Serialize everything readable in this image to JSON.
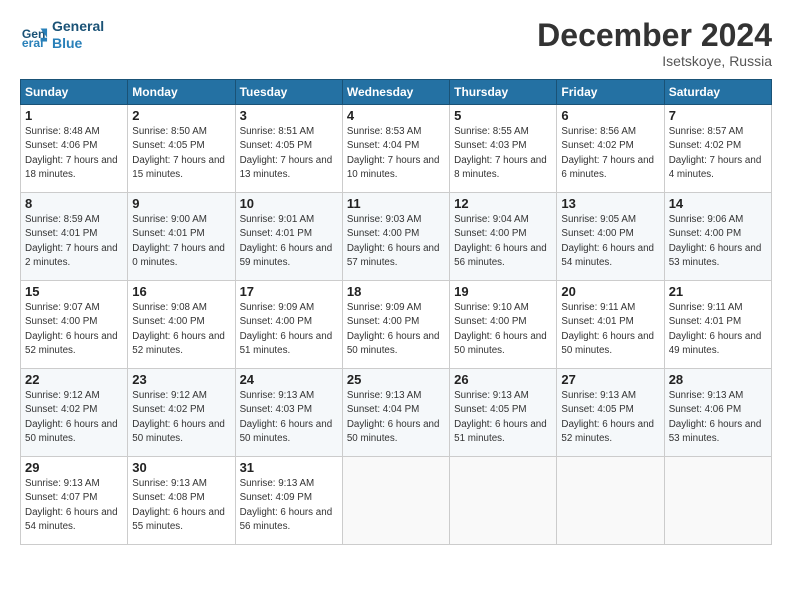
{
  "logo": {
    "line1": "General",
    "line2": "Blue"
  },
  "title": "December 2024",
  "location": "Isetskoye, Russia",
  "weekdays": [
    "Sunday",
    "Monday",
    "Tuesday",
    "Wednesday",
    "Thursday",
    "Friday",
    "Saturday"
  ],
  "weeks": [
    [
      {
        "day": "1",
        "rise": "Sunrise: 8:48 AM",
        "set": "Sunset: 4:06 PM",
        "daylight": "Daylight: 7 hours and 18 minutes."
      },
      {
        "day": "2",
        "rise": "Sunrise: 8:50 AM",
        "set": "Sunset: 4:05 PM",
        "daylight": "Daylight: 7 hours and 15 minutes."
      },
      {
        "day": "3",
        "rise": "Sunrise: 8:51 AM",
        "set": "Sunset: 4:05 PM",
        "daylight": "Daylight: 7 hours and 13 minutes."
      },
      {
        "day": "4",
        "rise": "Sunrise: 8:53 AM",
        "set": "Sunset: 4:04 PM",
        "daylight": "Daylight: 7 hours and 10 minutes."
      },
      {
        "day": "5",
        "rise": "Sunrise: 8:55 AM",
        "set": "Sunset: 4:03 PM",
        "daylight": "Daylight: 7 hours and 8 minutes."
      },
      {
        "day": "6",
        "rise": "Sunrise: 8:56 AM",
        "set": "Sunset: 4:02 PM",
        "daylight": "Daylight: 7 hours and 6 minutes."
      },
      {
        "day": "7",
        "rise": "Sunrise: 8:57 AM",
        "set": "Sunset: 4:02 PM",
        "daylight": "Daylight: 7 hours and 4 minutes."
      }
    ],
    [
      {
        "day": "8",
        "rise": "Sunrise: 8:59 AM",
        "set": "Sunset: 4:01 PM",
        "daylight": "Daylight: 7 hours and 2 minutes."
      },
      {
        "day": "9",
        "rise": "Sunrise: 9:00 AM",
        "set": "Sunset: 4:01 PM",
        "daylight": "Daylight: 7 hours and 0 minutes."
      },
      {
        "day": "10",
        "rise": "Sunrise: 9:01 AM",
        "set": "Sunset: 4:01 PM",
        "daylight": "Daylight: 6 hours and 59 minutes."
      },
      {
        "day": "11",
        "rise": "Sunrise: 9:03 AM",
        "set": "Sunset: 4:00 PM",
        "daylight": "Daylight: 6 hours and 57 minutes."
      },
      {
        "day": "12",
        "rise": "Sunrise: 9:04 AM",
        "set": "Sunset: 4:00 PM",
        "daylight": "Daylight: 6 hours and 56 minutes."
      },
      {
        "day": "13",
        "rise": "Sunrise: 9:05 AM",
        "set": "Sunset: 4:00 PM",
        "daylight": "Daylight: 6 hours and 54 minutes."
      },
      {
        "day": "14",
        "rise": "Sunrise: 9:06 AM",
        "set": "Sunset: 4:00 PM",
        "daylight": "Daylight: 6 hours and 53 minutes."
      }
    ],
    [
      {
        "day": "15",
        "rise": "Sunrise: 9:07 AM",
        "set": "Sunset: 4:00 PM",
        "daylight": "Daylight: 6 hours and 52 minutes."
      },
      {
        "day": "16",
        "rise": "Sunrise: 9:08 AM",
        "set": "Sunset: 4:00 PM",
        "daylight": "Daylight: 6 hours and 52 minutes."
      },
      {
        "day": "17",
        "rise": "Sunrise: 9:09 AM",
        "set": "Sunset: 4:00 PM",
        "daylight": "Daylight: 6 hours and 51 minutes."
      },
      {
        "day": "18",
        "rise": "Sunrise: 9:09 AM",
        "set": "Sunset: 4:00 PM",
        "daylight": "Daylight: 6 hours and 50 minutes."
      },
      {
        "day": "19",
        "rise": "Sunrise: 9:10 AM",
        "set": "Sunset: 4:00 PM",
        "daylight": "Daylight: 6 hours and 50 minutes."
      },
      {
        "day": "20",
        "rise": "Sunrise: 9:11 AM",
        "set": "Sunset: 4:01 PM",
        "daylight": "Daylight: 6 hours and 50 minutes."
      },
      {
        "day": "21",
        "rise": "Sunrise: 9:11 AM",
        "set": "Sunset: 4:01 PM",
        "daylight": "Daylight: 6 hours and 49 minutes."
      }
    ],
    [
      {
        "day": "22",
        "rise": "Sunrise: 9:12 AM",
        "set": "Sunset: 4:02 PM",
        "daylight": "Daylight: 6 hours and 50 minutes."
      },
      {
        "day": "23",
        "rise": "Sunrise: 9:12 AM",
        "set": "Sunset: 4:02 PM",
        "daylight": "Daylight: 6 hours and 50 minutes."
      },
      {
        "day": "24",
        "rise": "Sunrise: 9:13 AM",
        "set": "Sunset: 4:03 PM",
        "daylight": "Daylight: 6 hours and 50 minutes."
      },
      {
        "day": "25",
        "rise": "Sunrise: 9:13 AM",
        "set": "Sunset: 4:04 PM",
        "daylight": "Daylight: 6 hours and 50 minutes."
      },
      {
        "day": "26",
        "rise": "Sunrise: 9:13 AM",
        "set": "Sunset: 4:05 PM",
        "daylight": "Daylight: 6 hours and 51 minutes."
      },
      {
        "day": "27",
        "rise": "Sunrise: 9:13 AM",
        "set": "Sunset: 4:05 PM",
        "daylight": "Daylight: 6 hours and 52 minutes."
      },
      {
        "day": "28",
        "rise": "Sunrise: 9:13 AM",
        "set": "Sunset: 4:06 PM",
        "daylight": "Daylight: 6 hours and 53 minutes."
      }
    ],
    [
      {
        "day": "29",
        "rise": "Sunrise: 9:13 AM",
        "set": "Sunset: 4:07 PM",
        "daylight": "Daylight: 6 hours and 54 minutes."
      },
      {
        "day": "30",
        "rise": "Sunrise: 9:13 AM",
        "set": "Sunset: 4:08 PM",
        "daylight": "Daylight: 6 hours and 55 minutes."
      },
      {
        "day": "31",
        "rise": "Sunrise: 9:13 AM",
        "set": "Sunset: 4:09 PM",
        "daylight": "Daylight: 6 hours and 56 minutes."
      },
      null,
      null,
      null,
      null
    ]
  ]
}
